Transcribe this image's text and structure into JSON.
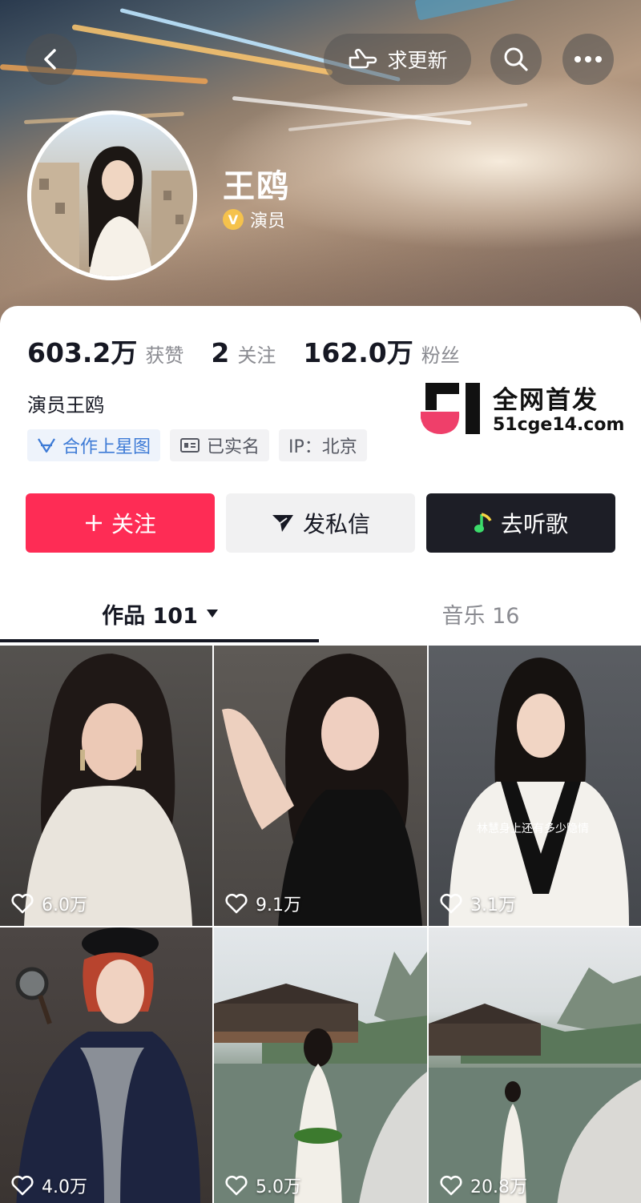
{
  "header": {
    "back_icon": "chevron-left-icon",
    "request_update_label": "求更新",
    "request_update_icon": "pointing-hand-icon",
    "search_icon": "search-icon",
    "more_icon": "more-dots-icon"
  },
  "profile": {
    "name": "王鸥",
    "verified_badge": "V",
    "role": "演员",
    "stats": [
      {
        "value": "603.2万",
        "label": "获赞"
      },
      {
        "value": "2",
        "label": "关注"
      },
      {
        "value": "162.0万",
        "label": "粉丝"
      }
    ],
    "bio": "演员王鸥",
    "tags": [
      {
        "label": "合作上星图",
        "icon": "star-map-icon"
      },
      {
        "label": "已实名",
        "icon": "id-card-icon"
      },
      {
        "label": "IP：北京"
      }
    ]
  },
  "watermark": {
    "line1": "全网首发",
    "line2": "51cge14.com"
  },
  "actions": {
    "follow_label": "关注",
    "message_label": "发私信",
    "music_label": "去听歌"
  },
  "tabs": [
    {
      "label": "作品 101",
      "active": true
    },
    {
      "label": "音乐 16",
      "active": false
    }
  ],
  "videos": [
    {
      "likes": "6.0万"
    },
    {
      "likes": "9.1万"
    },
    {
      "likes": "3.1万",
      "caption": "林慧身上还有多少隐情"
    },
    {
      "likes": "4.0万"
    },
    {
      "likes": "5.0万"
    },
    {
      "likes": "20.8万"
    }
  ],
  "colors": {
    "accent": "#fe2c55",
    "dark_button": "#1d1e26",
    "text_primary": "#161823",
    "text_secondary": "#8a8b91",
    "link_blue": "#3e7bd6"
  }
}
